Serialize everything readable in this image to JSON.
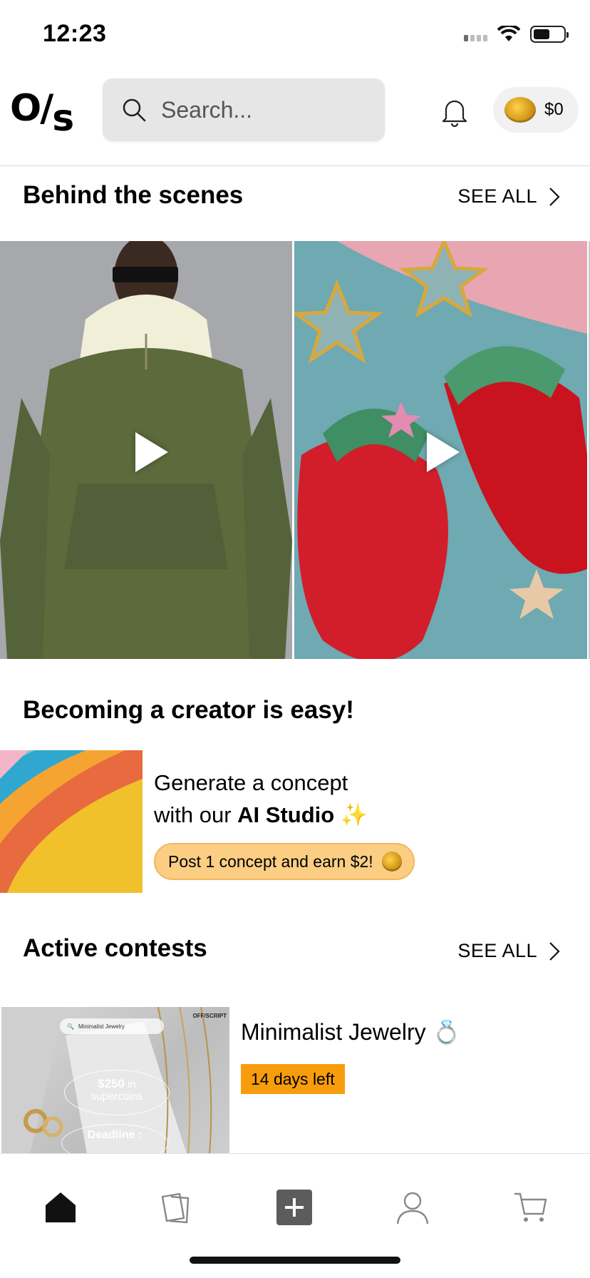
{
  "status_bar": {
    "time": "12:23"
  },
  "header": {
    "logo_left": "O/",
    "logo_right": "s",
    "search_placeholder": "Search...",
    "wallet_amount": "$0"
  },
  "behind_the_scenes": {
    "title": "Behind the scenes",
    "see_all": "SEE ALL",
    "videos": [
      {
        "icon": "play-icon"
      },
      {
        "icon": "play-icon"
      }
    ]
  },
  "creator": {
    "title": "Becoming a creator is easy!",
    "line1": "Generate a concept",
    "line2_prefix": "with our ",
    "line2_bold": "AI Studio",
    "line2_emoji": "✨",
    "earn_pill": "Post 1 concept and earn $2!"
  },
  "contests": {
    "title": "Active contests",
    "see_all": "SEE ALL",
    "items": [
      {
        "name": "Minimalist Jewelry",
        "emoji": "💍",
        "days_left": "14 days left",
        "image_search": "Minimalist Jewelry",
        "image_brand": "OFF/SCRIPT",
        "image_prize_amount": "$250",
        "image_prize_in": " in",
        "image_prize_unit": "supercoins",
        "image_deadline": "Deadline :"
      }
    ]
  },
  "bottom_nav": {
    "items": [
      "home-icon",
      "gallery-icon",
      "create-icon",
      "profile-icon",
      "cart-icon"
    ],
    "active": "home-icon"
  },
  "colors": {
    "accent_orange": "#f79d0d",
    "pill_background": "#fbce84",
    "search_background": "#e6e6e6"
  }
}
